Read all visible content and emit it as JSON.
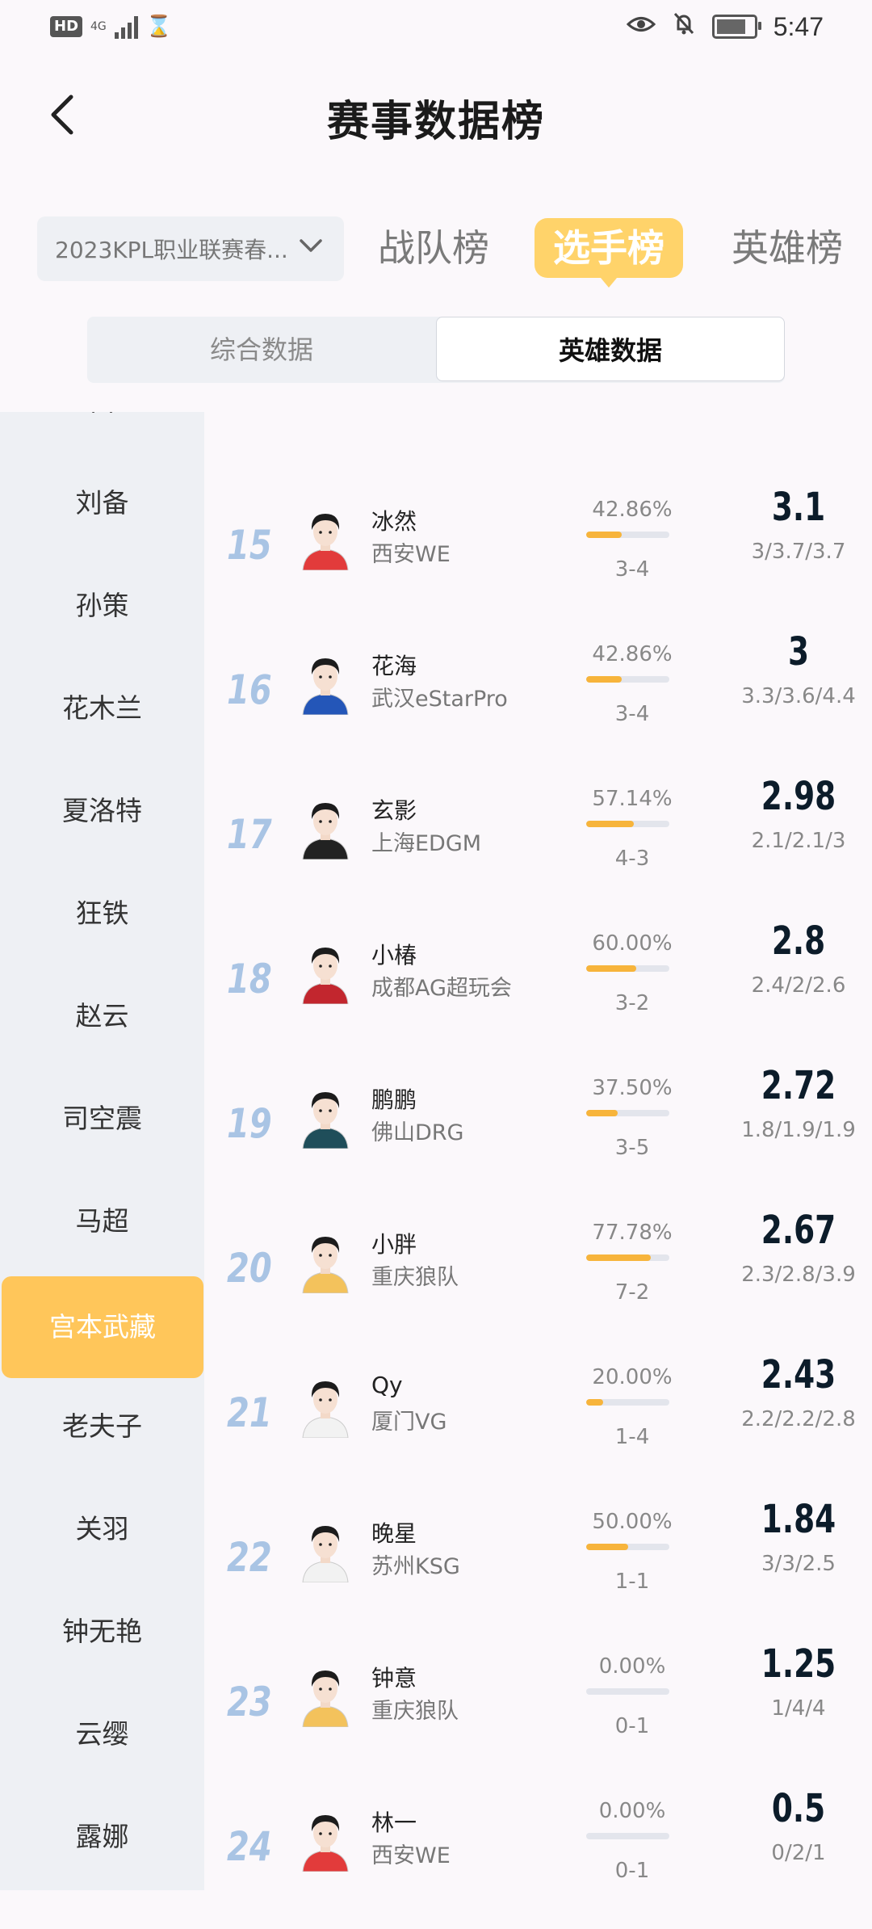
{
  "status_bar": {
    "hd": "HD",
    "network": "4G",
    "time": "5:47"
  },
  "header": {
    "title": "赛事数据榜"
  },
  "filters": {
    "season": "2023KPL职业联赛春...",
    "tabs": [
      "战队榜",
      "选手榜",
      "英雄榜"
    ],
    "active_tab": "选手榜"
  },
  "segments": {
    "general": "综合数据",
    "hero": "英雄数据",
    "active": "英雄数据"
  },
  "sidebar": {
    "partial_top": "吕",
    "items": [
      "刘备",
      "孙策",
      "花木兰",
      "夏洛特",
      "狂铁",
      "赵云",
      "司空震",
      "马超",
      "宫本武藏",
      "老夫子",
      "关羽",
      "钟无艳",
      "云缨",
      "露娜"
    ],
    "active": "宫本武藏"
  },
  "players": [
    {
      "rank": "15",
      "name": "冰然",
      "team": "西安WE",
      "win_rate": "42.86%",
      "win_fraction": 0.4286,
      "record": "3-4",
      "kda": "3.1",
      "kda_detail": "3/3.7/3.7",
      "jersey": "#e23b3b"
    },
    {
      "rank": "16",
      "name": "花海",
      "team": "武汉eStarPro",
      "win_rate": "42.86%",
      "win_fraction": 0.4286,
      "record": "3-4",
      "kda": "3",
      "kda_detail": "3.3/3.6/4.4",
      "jersey": "#2456b8"
    },
    {
      "rank": "17",
      "name": "玄影",
      "team": "上海EDGM",
      "win_rate": "57.14%",
      "win_fraction": 0.5714,
      "record": "4-3",
      "kda": "2.98",
      "kda_detail": "2.1/2.1/3",
      "jersey": "#222222"
    },
    {
      "rank": "18",
      "name": "小椿",
      "team": "成都AG超玩会",
      "win_rate": "60.00%",
      "win_fraction": 0.6,
      "record": "3-2",
      "kda": "2.8",
      "kda_detail": "2.4/2/2.6",
      "jersey": "#c2262e"
    },
    {
      "rank": "19",
      "name": "鹏鹏",
      "team": "佛山DRG",
      "win_rate": "37.50%",
      "win_fraction": 0.375,
      "record": "3-5",
      "kda": "2.72",
      "kda_detail": "1.8/1.9/1.9",
      "jersey": "#1f4e5a"
    },
    {
      "rank": "20",
      "name": "小胖",
      "team": "重庆狼队",
      "win_rate": "77.78%",
      "win_fraction": 0.7778,
      "record": "7-2",
      "kda": "2.67",
      "kda_detail": "2.3/2.8/3.9",
      "jersey": "#f3c25c"
    },
    {
      "rank": "21",
      "name": "Qy",
      "team": "厦门VG",
      "win_rate": "20.00%",
      "win_fraction": 0.2,
      "record": "1-4",
      "kda": "2.43",
      "kda_detail": "2.2/2.2/2.8",
      "jersey": "#f2f2f2"
    },
    {
      "rank": "22",
      "name": "晚星",
      "team": "苏州KSG",
      "win_rate": "50.00%",
      "win_fraction": 0.5,
      "record": "1-1",
      "kda": "1.84",
      "kda_detail": "3/3/2.5",
      "jersey": "#f2f2f2"
    },
    {
      "rank": "23",
      "name": "钟意",
      "team": "重庆狼队",
      "win_rate": "0.00%",
      "win_fraction": 0,
      "record": "0-1",
      "kda": "1.25",
      "kda_detail": "1/4/4",
      "jersey": "#f3c25c"
    },
    {
      "rank": "24",
      "name": "林一",
      "team": "西安WE",
      "win_rate": "0.00%",
      "win_fraction": 0,
      "record": "0-1",
      "kda": "0.5",
      "kda_detail": "0/2/1",
      "jersey": "#e23b3b"
    }
  ]
}
